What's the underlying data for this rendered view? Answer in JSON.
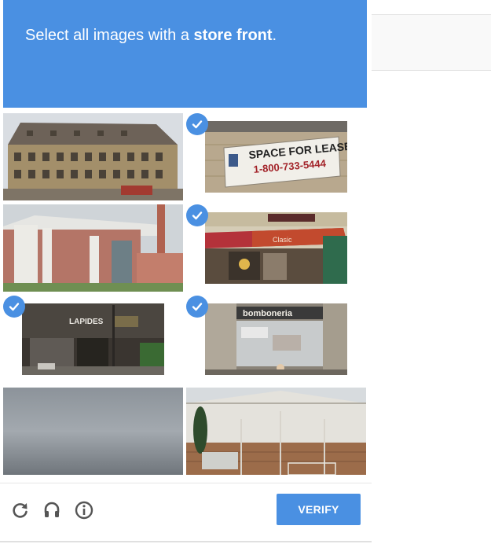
{
  "prompt": {
    "prefix": "Select all images with a ",
    "target": "store front",
    "suffix": "."
  },
  "tiles": [
    {
      "id": 1,
      "selected": false,
      "sign": ""
    },
    {
      "id": 2,
      "selected": true,
      "sign_line1": "SPACE FOR LEASE",
      "sign_line2": "1-800-733-5444"
    },
    {
      "id": 3,
      "selected": false,
      "sign": ""
    },
    {
      "id": 4,
      "selected": true,
      "sign": "Clasic"
    },
    {
      "id": 5,
      "selected": true,
      "sign": "LAPIDES"
    },
    {
      "id": 6,
      "selected": true,
      "sign": "bomboneria"
    },
    {
      "id": 7,
      "selected": false,
      "sign": ""
    },
    {
      "id": 8,
      "selected": false,
      "sign": ""
    }
  ],
  "footer": {
    "reload_icon": "reload-icon",
    "audio_icon": "headphones-icon",
    "info_icon": "info-icon",
    "verify_label": "VERIFY"
  },
  "colors": {
    "accent": "#4a90e2",
    "header_text": "#ffffff",
    "icon_gray": "#555555"
  }
}
